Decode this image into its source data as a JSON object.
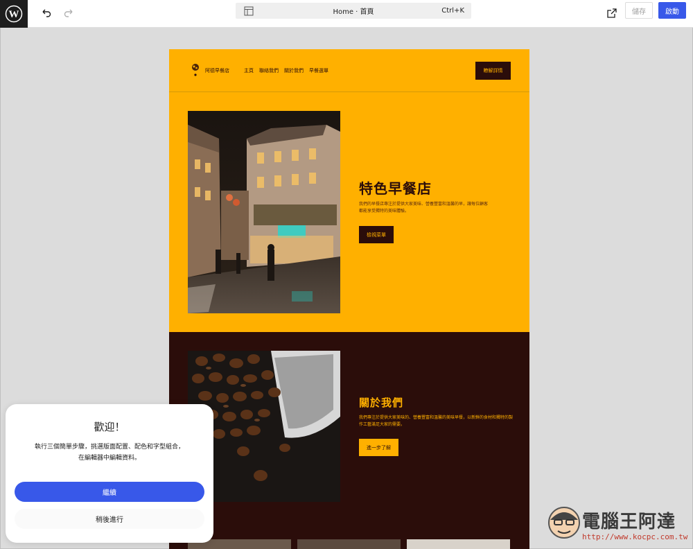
{
  "topbar": {
    "command_title": "Home · 首頁",
    "shortcut": "Ctrl+K",
    "save_label": "儲存",
    "activate_label": "啟動"
  },
  "site": {
    "title": "阿德早餐店",
    "nav": [
      "主頁",
      "聯絡我們",
      "關於我們",
      "早餐選單"
    ],
    "header_cta": "瞭解詳情",
    "hero": {
      "heading": "特色早餐店",
      "text": "我們的早餐店專注於提供大家美味、營養豐富和溫馨的早，讓每位顧客都能享受獨特的美味體驗。",
      "button": "檢視菜單"
    },
    "about": {
      "heading": "關於我們",
      "text": "我們專注於提供大家美味的、營養豐富和溫馨的美味早餐，以新鮮的食材和獨特的製作工藝滿足大家的需要。",
      "button": "進一步了解"
    }
  },
  "welcome": {
    "title": "歡迎！",
    "body_line1": "執行三個簡單步驟，挑選版面配置、配色和字型組合，",
    "body_line2": "在編輯器中編輯資料。",
    "continue": "繼續",
    "later": "稍後進行"
  },
  "watermark": {
    "text": "電腦王阿達",
    "url": "http://www.kocpc.com.tw"
  },
  "colors": {
    "brand_yellow": "#ffb000",
    "brand_dark": "#2b0d0a",
    "accent_blue": "#3858e9"
  }
}
